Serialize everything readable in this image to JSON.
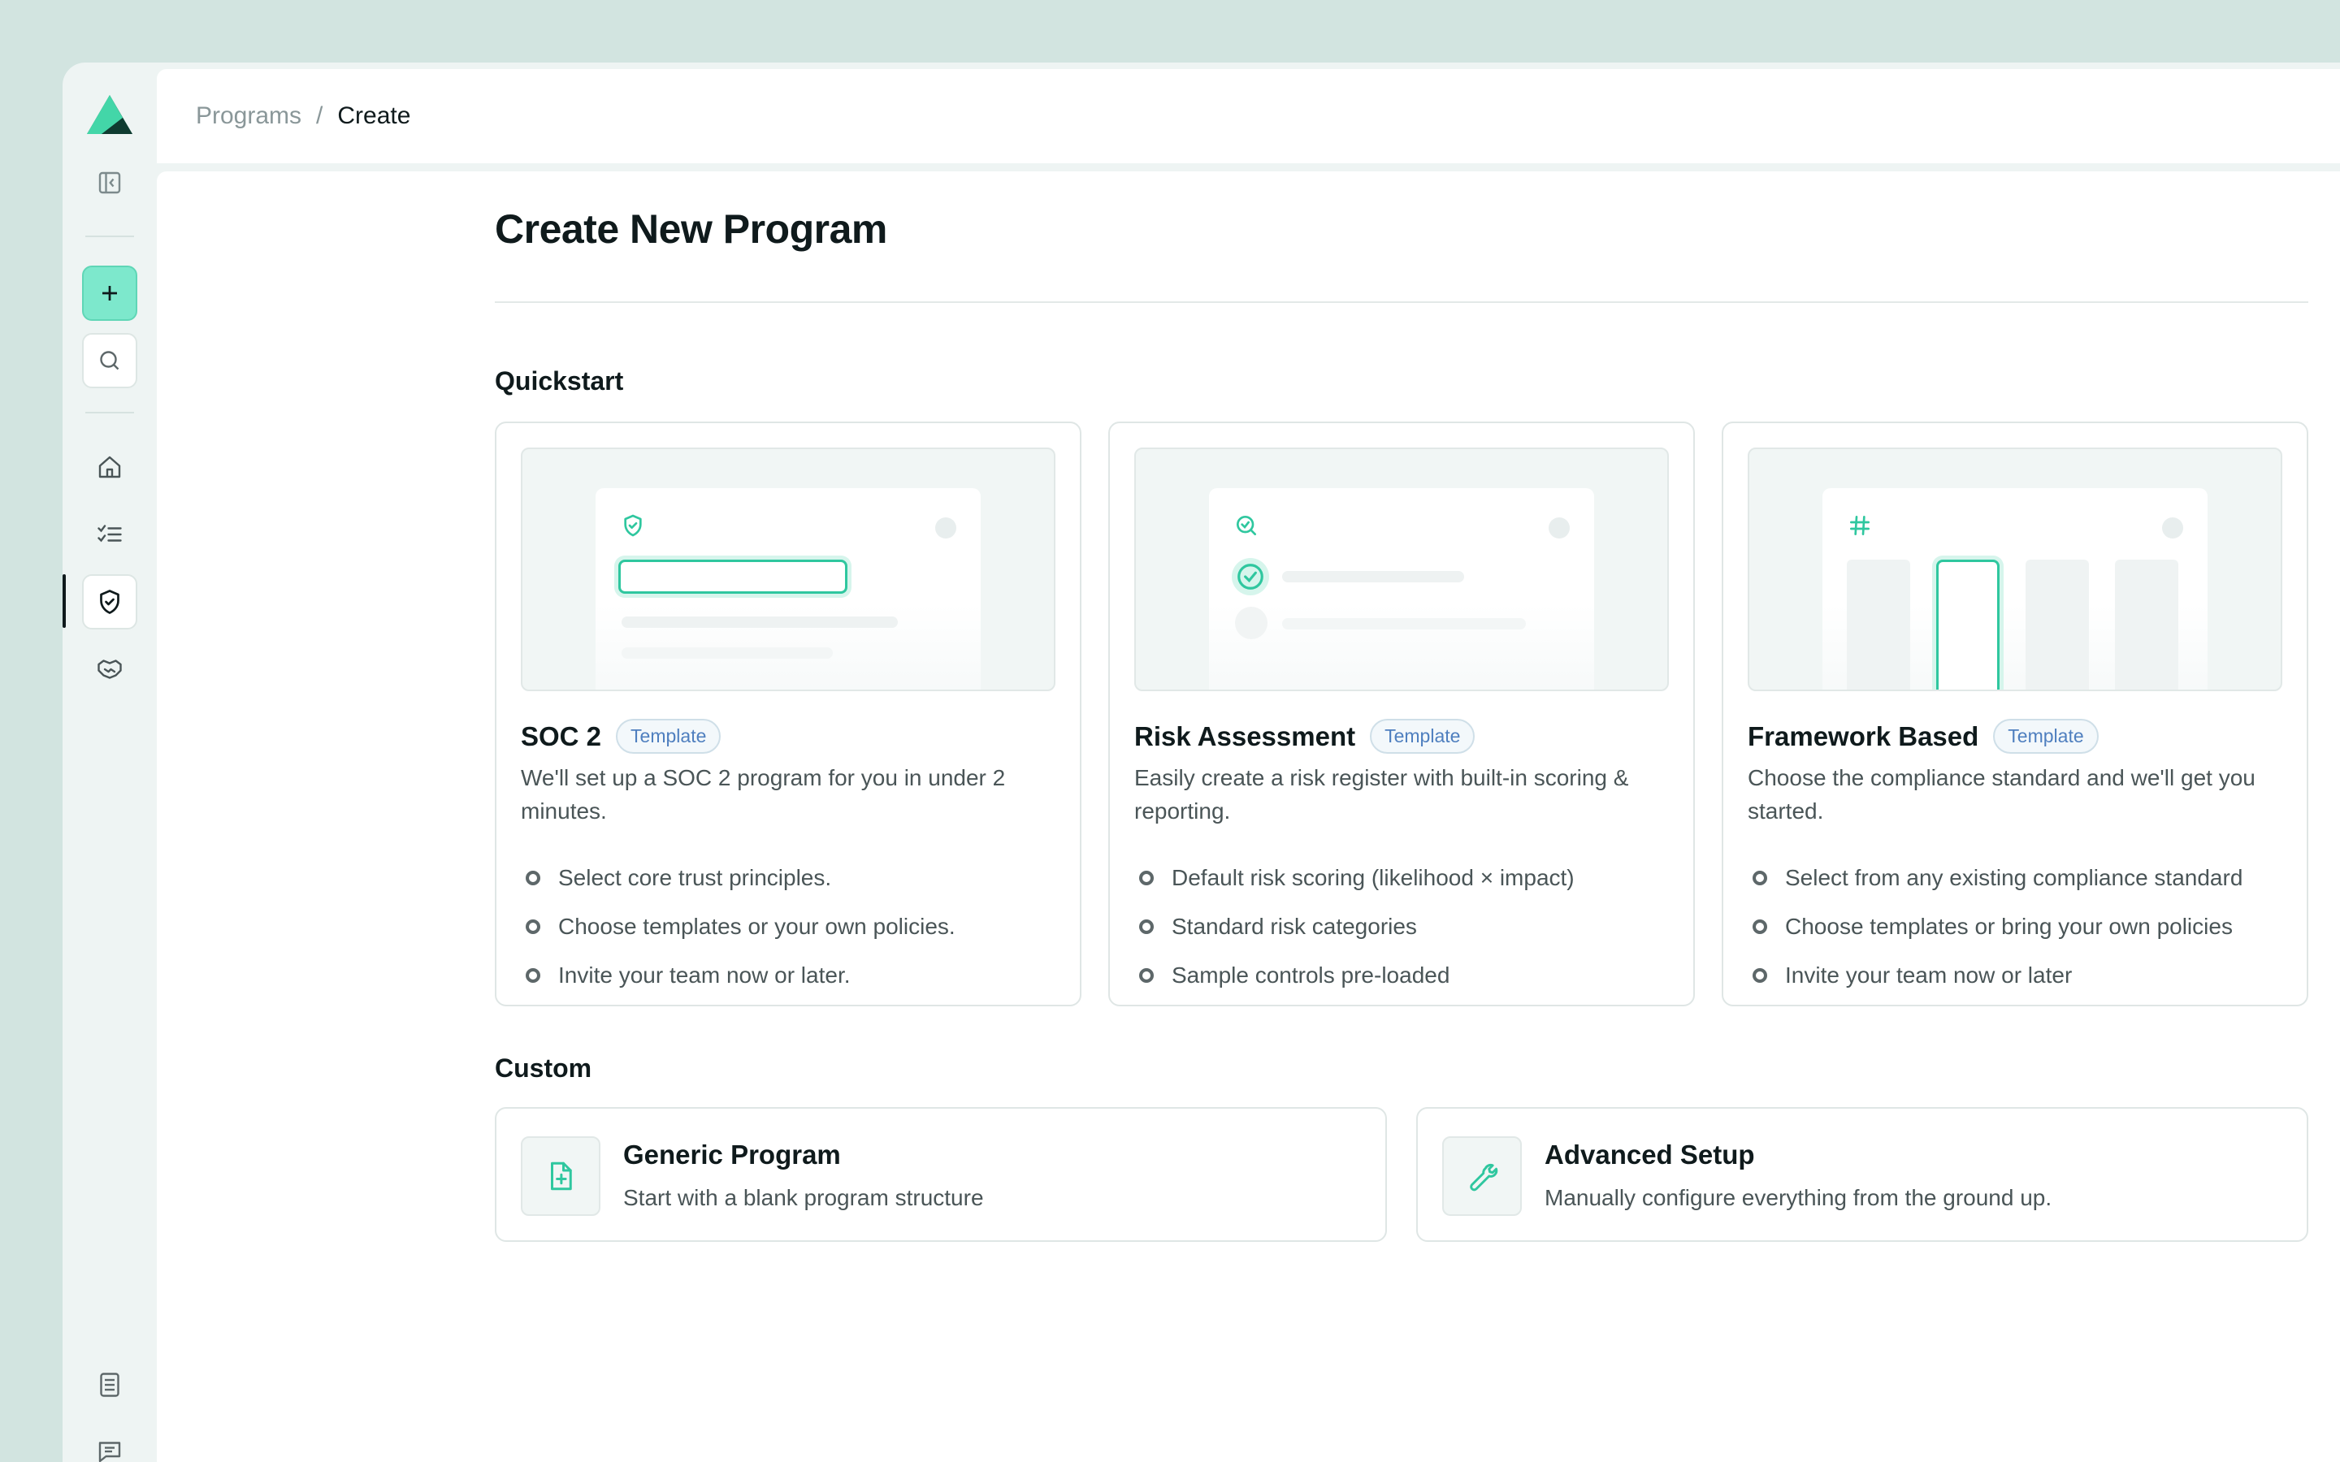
{
  "breadcrumb": {
    "parent": "Programs",
    "separator": "/",
    "current": "Create"
  },
  "page": {
    "title": "Create New Program"
  },
  "sidebar": {
    "items": [
      {
        "icon": "logo-icon"
      },
      {
        "icon": "collapse-sidebar-icon"
      },
      {
        "icon": "plus-icon"
      },
      {
        "icon": "search-icon"
      },
      {
        "icon": "home-icon"
      },
      {
        "icon": "checklist-icon"
      },
      {
        "icon": "shield-check-icon",
        "active": true
      },
      {
        "icon": "handshake-icon"
      },
      {
        "icon": "document-icon"
      },
      {
        "icon": "chat-icon"
      }
    ]
  },
  "quickstart": {
    "label": "Quickstart",
    "cards": [
      {
        "title": "SOC 2",
        "badge": "Template",
        "description": "We'll set up a SOC 2 program for you in under 2 minutes.",
        "bullets": [
          "Select core trust principles.",
          "Choose templates or your own policies.",
          "Invite your team now or later."
        ],
        "preview_icon": "shield-check-icon"
      },
      {
        "title": "Risk Assessment",
        "badge": "Template",
        "description": "Easily create a risk register with built-in scoring & reporting.",
        "bullets": [
          "Default risk scoring (likelihood × impact)",
          "Standard risk categories",
          "Sample controls pre-loaded"
        ],
        "preview_icon": "search-check-icon"
      },
      {
        "title": "Framework Based",
        "badge": "Template",
        "description": "Choose the compliance standard and we'll get you started.",
        "bullets": [
          "Select from any existing compliance standard",
          "Choose templates or bring your own policies",
          "Invite your team now or later"
        ],
        "preview_icon": "hash-icon"
      }
    ]
  },
  "custom": {
    "label": "Custom",
    "cards": [
      {
        "title": "Generic Program",
        "description": "Start with a blank program structure",
        "icon": "file-plus-icon"
      },
      {
        "title": "Advanced Setup",
        "description": "Manually configure everything from the ground up.",
        "icon": "wrench-icon"
      }
    ]
  },
  "colors": {
    "accent": "#2fc79f",
    "accent_light": "#7de8cc",
    "background": "#d2e4e0",
    "badge_text": "#4f7fbf"
  }
}
